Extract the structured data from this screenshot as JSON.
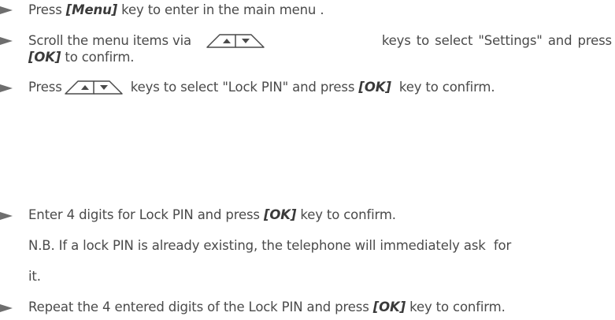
{
  "steps": {
    "s1": {
      "pre": "Press ",
      "key": "[Menu]",
      "post": " key to enter in the main menu ."
    },
    "s2": {
      "pre": "Scroll the menu items via",
      "post": "keys to select \"Settings\" and press",
      "key": "[OK]",
      "post2": " to confirm."
    },
    "s3": {
      "pre": "Press ",
      "post": " keys to select \"Lock PIN\" and press ",
      "key": "[OK]",
      "post2": "  key to confirm."
    },
    "s4": {
      "pre": "Enter 4 digits for Lock PIN and press ",
      "key": "[OK]",
      "post": " key to confirm."
    },
    "note": {
      "line1": "N.B. If a lock PIN is already existing, the telephone will immediately ask  for",
      "line2": "it."
    },
    "s5": {
      "pre": "Repeat the 4 entered digits of the Lock PIN and press ",
      "key": "[OK]",
      "post": " key to confirm."
    }
  },
  "icons": {
    "bullet": "arrow-bullet-icon",
    "up": "up-arrow-key-icon",
    "down": "down-arrow-key-icon"
  }
}
